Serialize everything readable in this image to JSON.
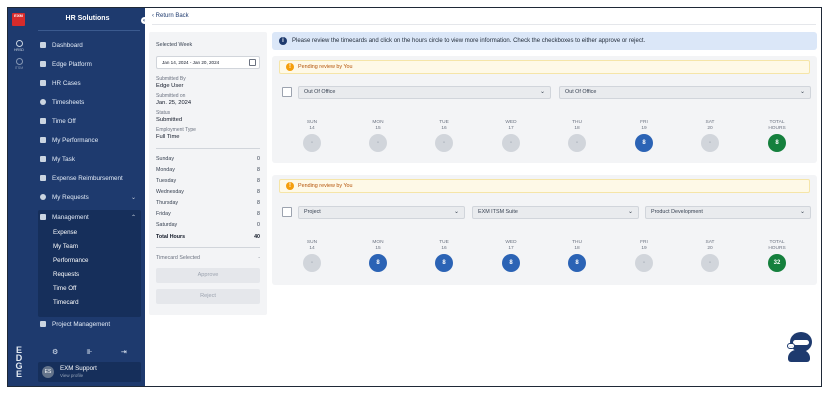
{
  "rail": {
    "logo_text": "EXM",
    "items": [
      {
        "label": "HRSD"
      },
      {
        "label": "ITSM"
      }
    ],
    "brand": "EDGE"
  },
  "sidebar": {
    "title": "HR Solutions",
    "items": [
      {
        "label": "Dashboard",
        "icon": "grid-icon"
      },
      {
        "label": "Edge Platform",
        "icon": "document-icon"
      },
      {
        "label": "HR Cases",
        "icon": "cases-icon"
      },
      {
        "label": "Timesheets",
        "icon": "clock-icon"
      },
      {
        "label": "Time Off",
        "icon": "calendar-icon"
      },
      {
        "label": "My Performance",
        "icon": "performance-icon"
      },
      {
        "label": "My Task",
        "icon": "task-icon"
      },
      {
        "label": "Expense Reimbursement",
        "icon": "receipt-icon"
      },
      {
        "label": "My Requests",
        "icon": "requests-icon"
      },
      {
        "label": "Management",
        "icon": "management-icon"
      }
    ],
    "management_sub": [
      "Expense",
      "My Team",
      "Performance",
      "Requests",
      "Time Off",
      "Timecard"
    ],
    "project_management": "Project Management",
    "user": {
      "initials": "ES",
      "name": "EXM Support",
      "sub": "View profile"
    }
  },
  "main": {
    "back_label": "Return Back",
    "info_text": "Please review the timecards and click on the hours circle to view more information. Check the checkboxes to either approve or reject.",
    "left_panel": {
      "selected_week_label": "Selected Week",
      "selected_week_value": "Jan 14, 2024 - Jan 20, 2024",
      "submitted_by_label": "Submitted By",
      "submitted_by_value": "Edge User",
      "submitted_on_label": "Submitted on",
      "submitted_on_value": "Jan. 25, 2024",
      "status_label": "Status",
      "status_value": "Submitted",
      "employment_label": "Employment Type",
      "employment_value": "Full Time",
      "days": [
        {
          "day": "Sunday",
          "hours": "0"
        },
        {
          "day": "Monday",
          "hours": "8"
        },
        {
          "day": "Tuesday",
          "hours": "8"
        },
        {
          "day": "Wednesday",
          "hours": "8"
        },
        {
          "day": "Thursday",
          "hours": "8"
        },
        {
          "day": "Friday",
          "hours": "8"
        },
        {
          "day": "Saturday",
          "hours": "0"
        }
      ],
      "total_label": "Total Hours",
      "total_value": "40",
      "timecard_selected_label": "Timecard Selected",
      "timecard_selected_value": "-",
      "approve_label": "Approve",
      "reject_label": "Reject"
    },
    "day_headers": [
      {
        "d": "SUN",
        "n": "14"
      },
      {
        "d": "MON",
        "n": "15"
      },
      {
        "d": "TUE",
        "n": "16"
      },
      {
        "d": "WED",
        "n": "17"
      },
      {
        "d": "THU",
        "n": "18"
      },
      {
        "d": "FRI",
        "n": "19"
      },
      {
        "d": "SAT",
        "n": "20"
      },
      {
        "d": "TOTAL",
        "n": "HOURS"
      }
    ],
    "cards": [
      {
        "pending": "Pending review by You",
        "selects": [
          "Out Of Office",
          "Out Of Office"
        ],
        "hours": [
          "-",
          "-",
          "-",
          "-",
          "-",
          "8",
          "-",
          "8"
        ]
      },
      {
        "pending": "Pending review by You",
        "selects": [
          "Project",
          "EXM ITSM Suite",
          "Product Development"
        ],
        "hours": [
          "-",
          "8",
          "8",
          "8",
          "8",
          "-",
          "-",
          "32"
        ]
      }
    ]
  },
  "colors": {
    "sidebar_bg": "#1e3a6e",
    "hours_blue": "#2b63b5",
    "total_green": "#15803d",
    "info_bg": "#dbe7f8",
    "pending_text": "#b45309"
  }
}
